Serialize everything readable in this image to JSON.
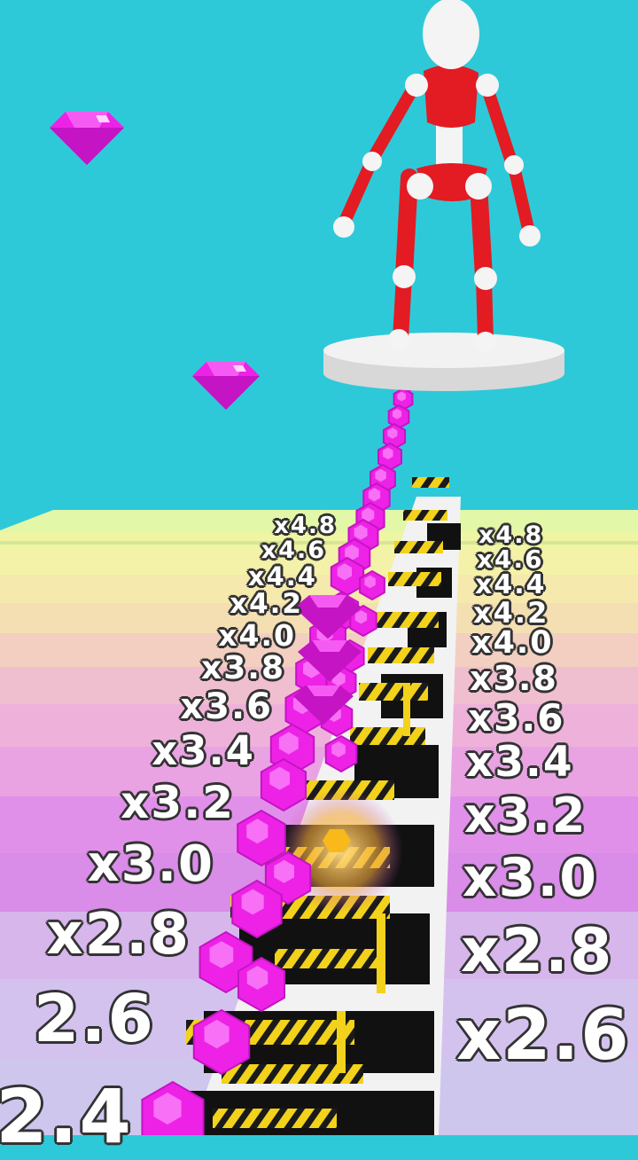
{
  "scene": {
    "sky_color": "#2ec9d8",
    "character": "red-white-mannequin",
    "collectible": "pink-gem"
  },
  "colors": {
    "gem": "#ee22e6",
    "character_red": "#e31b23",
    "hazard_yellow": "#f2d21b",
    "track_black": "#111111",
    "track_white": "#f2f2f2",
    "platform": "#f0f0f0"
  },
  "multipliers": {
    "left": [
      "x4.8",
      "x4.6",
      "x4.4",
      "x4.2",
      "x4.0",
      "x3.8",
      "x3.6",
      "x3.4",
      "x3.2",
      "x3.0",
      "x2.8",
      "2.6",
      "2.4"
    ],
    "right": [
      "x4.8",
      "x4.6",
      "x4.4",
      "x4.2",
      "x4.0",
      "x3.8",
      "x3.6",
      "x3.4",
      "x3.2",
      "x3.0",
      "x2.8",
      "x2.6"
    ]
  }
}
